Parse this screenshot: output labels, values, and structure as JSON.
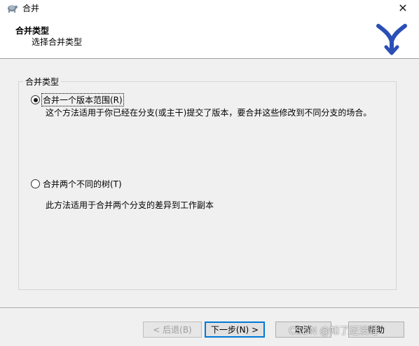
{
  "window": {
    "title": "合并",
    "close_glyph": "✕",
    "app_icon": "tortoise-icon"
  },
  "header": {
    "title": "合并类型",
    "subtitle": "选择合并类型",
    "logo_icon": "merge-branch-icon",
    "logo_color": "#2a4fb5"
  },
  "group": {
    "legend": "合并类型",
    "options": [
      {
        "label": "合并一个版本范围(R)",
        "description": "这个方法适用于你已经在分支(或主干)提交了版本，要合并这些修改到不同分支的场合。",
        "checked": true
      },
      {
        "label": "合并两个不同的树(T)",
        "description": "此方法适用于合并两个分支的差异到工作副本",
        "checked": false
      }
    ]
  },
  "buttons": {
    "back": "< 后退(B)",
    "next": "下一步(N) >",
    "cancel": "取消",
    "help": "帮助"
  },
  "watermark": "CSDN @知了还没睡",
  "colors": {
    "focus_border": "#0078d7",
    "disabled_text": "#9c9c9c"
  }
}
